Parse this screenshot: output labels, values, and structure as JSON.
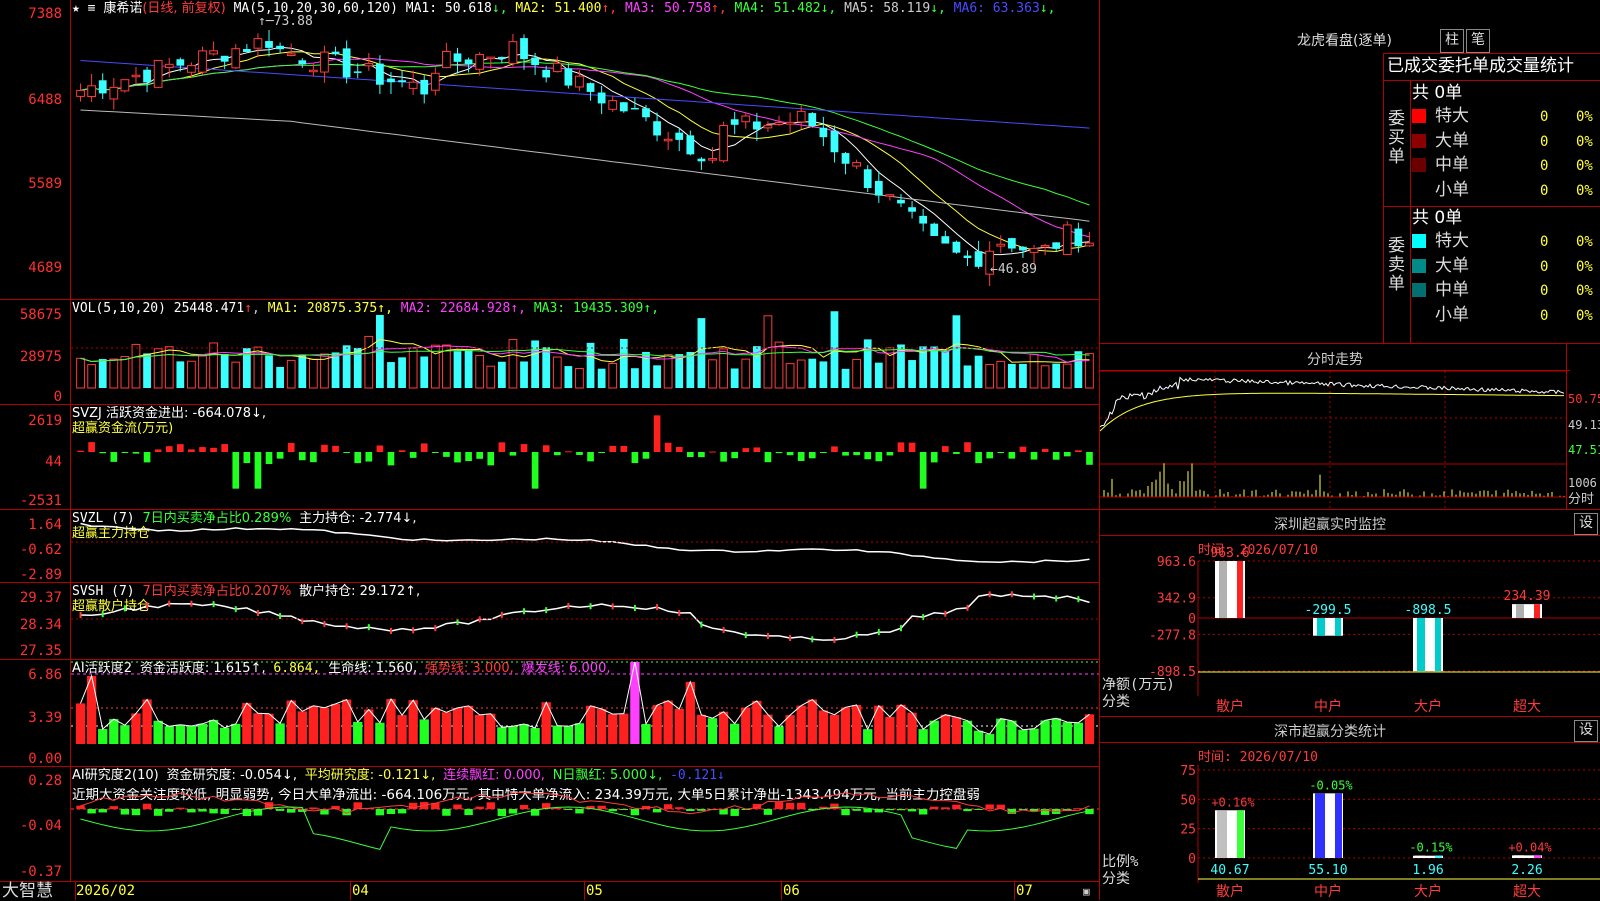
{
  "stock": {
    "name": "康希诺",
    "mode": "(日线, 前复权)",
    "ma_label": "MA(5,10,20,30,60,120)",
    "ma": [
      {
        "label": "MA1:",
        "value": "50.618",
        "arrow": "↓",
        "color": "#ffffff"
      },
      {
        "label": "MA2:",
        "value": "51.400",
        "arrow": "↑",
        "color": "#ffff3b"
      },
      {
        "label": "MA3:",
        "value": "50.758",
        "arrow": "↑",
        "color": "#ff40ff"
      },
      {
        "label": "MA4:",
        "value": "51.482",
        "arrow": "↓",
        "color": "#3bff3b"
      },
      {
        "label": "MA5:",
        "value": "58.119",
        "arrow": "↓",
        "color": "#cccccc"
      },
      {
        "label": "MA6:",
        "value": "63.363",
        "arrow": "↓",
        "color": "#4a4aff"
      }
    ],
    "high_mark": "73.88",
    "low_mark": "46.89",
    "y_ticks": [
      "7388",
      "6488",
      "5589",
      "4689"
    ]
  },
  "vol": {
    "label": "VOL(5,10,20)",
    "value": "25448.471",
    "arrow": "↑",
    "ma": [
      {
        "t": "MA1: 20875.375↑",
        "c": "#ffff3b"
      },
      {
        "t": "MA2: 22684.928↑",
        "c": "#ff40ff"
      },
      {
        "t": "MA3: 19435.309↑",
        "c": "#3bff3b"
      }
    ],
    "y_ticks": [
      "58675",
      "28975",
      "0"
    ]
  },
  "svzj": {
    "label": "SVZJ  活跃资金进出: -664.078↓,",
    "sub": "超赢资金流(万元)",
    "y_ticks": [
      "2619",
      "44",
      "-2531"
    ]
  },
  "svzl": {
    "label": "SVZL (7)",
    "ratio": "7日内买卖净占比0.289%",
    "pos": "主力持仓: -2.774↓,",
    "sub": "超赢主力持仓",
    "y_ticks": [
      "1.64",
      "-0.62",
      "-2.89"
    ]
  },
  "svsh": {
    "label": "SVSH (7)",
    "ratio": "7日内买卖净占比0.207%",
    "pos": "散户持仓: 29.172↑,",
    "sub": "超赢散户持仓",
    "y_ticks": [
      "29.37",
      "28.34",
      "27.35"
    ]
  },
  "ai1": {
    "label": "AI活跃度2",
    "t1": "资金活跃度: 1.615↑,",
    "t2": "6.864,",
    "t3": "生命线: 1.560,",
    "t4": "强势线: 3.000,",
    "t5": "爆发线: 6.000,",
    "y_ticks": [
      "6.86",
      "3.39",
      "0.00"
    ]
  },
  "ai2": {
    "label": "AI研究度2(10)",
    "t1": "资金研究度: -0.054↓,",
    "t2": "平均研究度: -0.121↓,",
    "t3": "连续飘红: 0.000,",
    "t4": "N日飘红: 5.000↓,",
    "t5": "-0.121↓",
    "comment": "近期大资金关注度较低, 明显弱势, 今日大单净流出: -664.106万元, 其中特大单净流入: 234.39万元, 大单5日累计净出-1343.494万元, 当前主力控盘弱",
    "y_ticks": [
      "0.28",
      "-0.04",
      "-0.37"
    ]
  },
  "x_axis": {
    "brand": "大智慧",
    "labels": [
      "2026/02",
      "04",
      "05",
      "06",
      "07"
    ]
  },
  "right": {
    "longhu_title": "龙虎看盘(逐单)",
    "btn_zhu": "柱",
    "btn_bi": "笔",
    "stat_title": "已成交委托单成交量统计",
    "buy_side": "委买单",
    "sell_side": "委卖单",
    "buy_total": "共 0单",
    "sell_total": "共 0单",
    "buy_rows": [
      {
        "name": "特大",
        "v": "0",
        "pct": "0%",
        "color": "#ff0000"
      },
      {
        "name": "大单",
        "v": "0",
        "pct": "0%",
        "color": "#8b0000"
      },
      {
        "name": "中单",
        "v": "0",
        "pct": "0%",
        "color": "#6b0000"
      },
      {
        "name": "小单",
        "v": "0",
        "pct": "0%",
        "color": "#000000"
      }
    ],
    "sell_rows": [
      {
        "name": "特大",
        "v": "0",
        "pct": "0%",
        "color": "#00ffff"
      },
      {
        "name": "大单",
        "v": "0",
        "pct": "0%",
        "color": "#008b8b"
      },
      {
        "name": "中单",
        "v": "0",
        "pct": "0%",
        "color": "#007070"
      },
      {
        "name": "小单",
        "v": "0",
        "pct": "0%",
        "color": "#000000"
      }
    ],
    "fenshi_title": "分时走势",
    "fenshi_y": [
      "50.75",
      "49.13",
      "47.51"
    ],
    "fenshi_vol": "1006",
    "fenshi_lbl": "分时",
    "monitor_title": "深圳超赢实时监控",
    "monitor_btn": "设",
    "monitor_time": "时间: 2026/07/10",
    "monitor_y": [
      "963.6",
      "342.9",
      "0",
      "-277.8",
      "-898.5"
    ],
    "monitor_bars": [
      {
        "cat": "散户",
        "value": 963.6,
        "label": "963.6"
      },
      {
        "cat": "中户",
        "value": -299.5,
        "label": "-299.5"
      },
      {
        "cat": "大户",
        "value": -898.5,
        "label": "-898.5"
      },
      {
        "cat": "超大",
        "value": 234.39,
        "label": "234.39"
      }
    ],
    "monitor_ylabel": "净额(万元)",
    "monitor_xlabel": "分类",
    "stat2_title": "深市超赢分类统计",
    "stat2_btn": "设",
    "stat2_time": "时间: 2026/07/10",
    "stat2_y": [
      "75",
      "50",
      "25",
      "0"
    ],
    "stat2_bars": [
      {
        "cat": "散户",
        "value": 40.67,
        "label": "40.67",
        "chg": "+0.16%"
      },
      {
        "cat": "中户",
        "value": 55.1,
        "label": "55.10",
        "chg": "-0.05%"
      },
      {
        "cat": "大户",
        "value": 1.96,
        "label": "1.96",
        "chg": "-0.15%"
      },
      {
        "cat": "超大",
        "value": 2.26,
        "label": "2.26",
        "chg": "+0.04%"
      }
    ],
    "stat2_ylabel": "比例%",
    "stat2_xlabel": "分类"
  }
}
